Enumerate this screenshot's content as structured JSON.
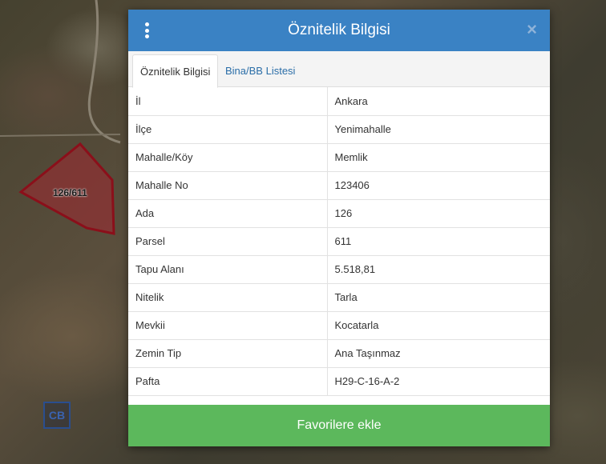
{
  "map": {
    "parcel_label": "126/611",
    "logo_text": "CB"
  },
  "dialog": {
    "title": "Öznitelik Bilgisi",
    "close_symbol": "×",
    "tabs": [
      {
        "label": "Öznitelik Bilgisi",
        "active": true
      },
      {
        "label": "Bina/BB Listesi",
        "active": false
      }
    ],
    "rows": [
      {
        "key": "İl",
        "value": "Ankara"
      },
      {
        "key": "İlçe",
        "value": "Yenimahalle"
      },
      {
        "key": "Mahalle/Köy",
        "value": "Memlik"
      },
      {
        "key": "Mahalle No",
        "value": "123406"
      },
      {
        "key": "Ada",
        "value": "126"
      },
      {
        "key": "Parsel",
        "value": "611"
      },
      {
        "key": "Tapu Alanı",
        "value": "5.518,81"
      },
      {
        "key": "Nitelik",
        "value": "Tarla"
      },
      {
        "key": "Mevkii",
        "value": "Kocatarla"
      },
      {
        "key": "Zemin Tip",
        "value": "Ana Taşınmaz"
      },
      {
        "key": "Pafta",
        "value": "H29-C-16-A-2"
      }
    ],
    "favorite_button": "Favorilere ekle"
  },
  "colors": {
    "header": "#3a82c4",
    "button": "#5cb85c",
    "parcel_outline": "#8b0f1a"
  }
}
